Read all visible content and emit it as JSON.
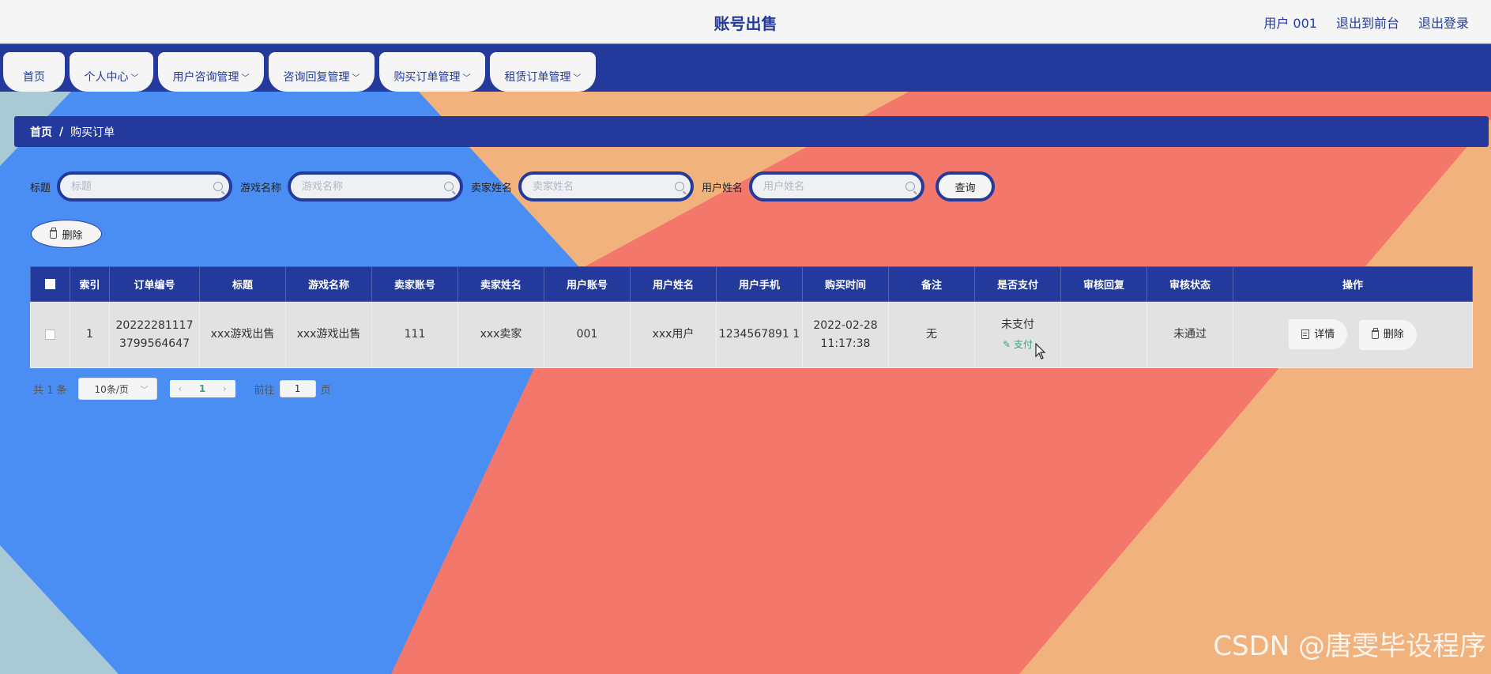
{
  "header": {
    "title": "账号出售",
    "user": "用户 001",
    "exit_front": "退出到前台",
    "logout": "退出登录"
  },
  "nav": {
    "tabs": [
      {
        "label": "首页",
        "has_caret": false
      },
      {
        "label": "个人中心",
        "has_caret": true
      },
      {
        "label": "用户咨询管理",
        "has_caret": true
      },
      {
        "label": "咨询回复管理",
        "has_caret": true
      },
      {
        "label": "购买订单管理",
        "has_caret": true
      },
      {
        "label": "租赁订单管理",
        "has_caret": true
      }
    ]
  },
  "breadcrumb": {
    "home": "首页",
    "separator": "/",
    "current": "购买订单"
  },
  "search": {
    "title_label": "标题",
    "title_placeholder": "标题",
    "game_label": "游戏名称",
    "game_placeholder": "游戏名称",
    "seller_label": "卖家姓名",
    "seller_placeholder": "卖家姓名",
    "user_label": "用户姓名",
    "user_placeholder": "用户姓名",
    "query_label": "查询"
  },
  "toolbar": {
    "delete_label": "删除"
  },
  "table": {
    "headers": [
      "索引",
      "订单编号",
      "标题",
      "游戏名称",
      "卖家账号",
      "卖家姓名",
      "用户账号",
      "用户姓名",
      "用户手机",
      "购买时间",
      "备注",
      "是否支付",
      "审核回复",
      "审核状态",
      "操作"
    ],
    "rows": [
      {
        "index": "1",
        "order_no": "20222281117 3799564647",
        "title": "xxx游戏出售",
        "game": "xxx游戏出售",
        "seller_account": "111",
        "seller_name": "xxx卖家",
        "user_account": "001",
        "user_name": "xxx用户",
        "user_phone": "1234567891 1",
        "purchase_time": "2022-02-28 11:17:38",
        "remark": "无",
        "paid": "未支付",
        "pay_link": "支付",
        "review_reply": "",
        "review_status": "未通过",
        "detail_label": "详情",
        "delete_label": "删除"
      }
    ]
  },
  "pager": {
    "total": "共 1 条",
    "page_size": "10条/页",
    "current_page": "1",
    "goto_label": "前往",
    "goto_value": "1",
    "page_unit": "页"
  },
  "watermark": "CSDN @唐雯毕设程序",
  "colors": {
    "primary": "#233a9c",
    "accent_green": "#3aa47c",
    "bg_blue": "#4a8ef3",
    "bg_coral": "#f3776a",
    "bg_peach": "#f2b27e",
    "bg_teal": "#a9cad4"
  }
}
